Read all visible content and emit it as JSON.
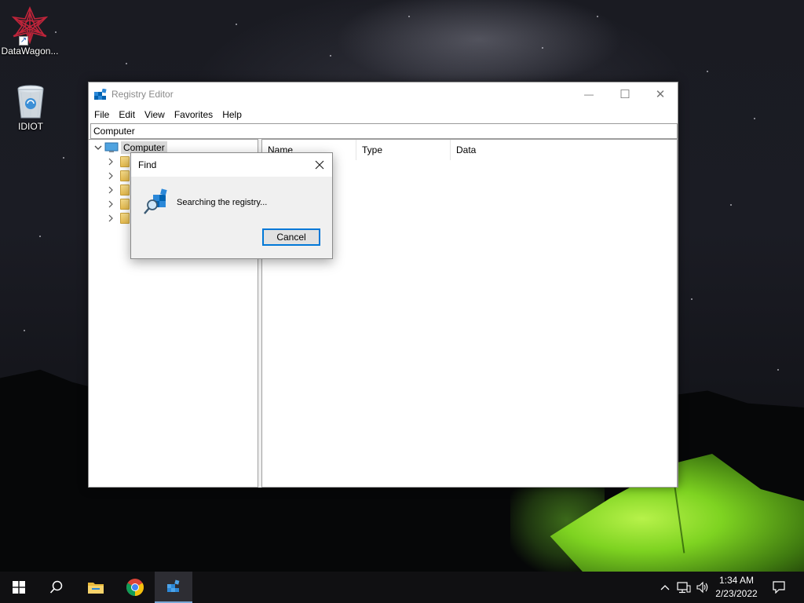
{
  "desktop": {
    "icons": [
      {
        "label": "DataWagon...",
        "icon": "datawagon-shortcut-icon"
      },
      {
        "label": "IDIOT",
        "icon": "recycle-bin-icon"
      }
    ]
  },
  "window": {
    "title": "Registry Editor",
    "controls": {
      "minimize": "—",
      "maximize": "☐",
      "close": "✕"
    },
    "menu": [
      "File",
      "Edit",
      "View",
      "Favorites",
      "Help"
    ],
    "address": "Computer",
    "tree": {
      "root_label": "Computer",
      "collapsed_children": 5
    },
    "columns": [
      "Name",
      "Type",
      "Data"
    ]
  },
  "find_dialog": {
    "title": "Find",
    "message": "Searching the registry...",
    "cancel_label": "Cancel"
  },
  "taskbar": {
    "pinned": [
      "start-icon",
      "search-icon",
      "file-explorer-icon",
      "chrome-icon",
      "registry-editor-icon"
    ],
    "active": "registry-editor-icon",
    "clock": {
      "time": "1:34 AM",
      "date": "2/23/2022"
    }
  },
  "colors": {
    "accent": "#0078d7",
    "taskbar": "#101012",
    "dialog_bg": "#f0f0f0"
  }
}
